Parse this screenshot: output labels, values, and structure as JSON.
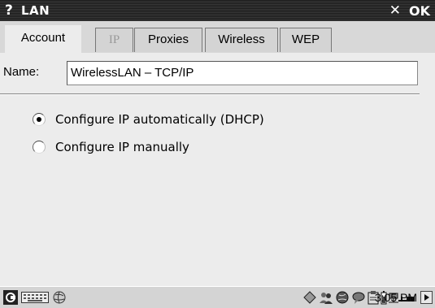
{
  "titlebar": {
    "help": "?",
    "title": "LAN",
    "close": "✕",
    "ok": "OK"
  },
  "tabs": [
    {
      "label": "Account",
      "state": "active"
    },
    {
      "label": "IP",
      "state": "disabled"
    },
    {
      "label": "Proxies",
      "state": "normal"
    },
    {
      "label": "Wireless",
      "state": "normal"
    },
    {
      "label": "WEP",
      "state": "normal"
    }
  ],
  "form": {
    "name_label": "Name:",
    "name_value": "WirelessLAN – TCP/IP"
  },
  "options": [
    {
      "label": "Configure IP automatically (DHCP)",
      "selected": true
    },
    {
      "label": "Configure IP manually",
      "selected": false
    }
  ],
  "taskbar": {
    "clock": "3:05 PM",
    "left_icons": [
      "start-menu-icon",
      "keyboard-icon",
      "network-globe-icon"
    ],
    "tray_icons": [
      "diamond-icon",
      "people-icon",
      "globe-icon",
      "speech-bubble-icon",
      "clipboard-icon",
      "battery-icon",
      "network-icon",
      "signal-icon"
    ]
  }
}
